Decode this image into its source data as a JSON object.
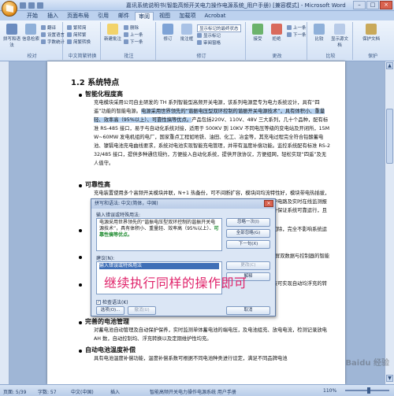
{
  "window": {
    "title": "嘉讯系统说明书(智能高频开关电力操作电源系统_用户手册) [兼容模式] - Microsoft Word",
    "buttons": [
      "–",
      "□",
      "×"
    ]
  },
  "ribbon_tabs": [
    "开始",
    "插入",
    "页面布局",
    "引用",
    "邮件",
    "审阅",
    "视图",
    "加载项",
    "Acrobat"
  ],
  "active_tab": "审阅",
  "ribbon": {
    "groups": [
      "校对",
      "中文简繁转换",
      "批注",
      "修订",
      "更改",
      "比较",
      "保护"
    ],
    "buttons": {
      "spell": "拼写和语法",
      "research": "信息检索",
      "translate": "翻译",
      "tooltip": "翻译屏幕提示",
      "language": "设置语言",
      "wordcount": "字数统计",
      "to_simplified": "繁转简",
      "to_traditional": "简转繁",
      "convert": "简繁转换",
      "new_comment": "新建批注",
      "delete": "删除",
      "prev": "上一条",
      "next": "下一条",
      "track": "修订",
      "balloon": "批注框",
      "markup_combo": "显示标记的最终状态",
      "show_markup": "显示标记",
      "review_pane": "审阅窗格",
      "accept": "接受",
      "reject": "拒绝",
      "change_prev": "上一条",
      "change_next": "下一条",
      "compare": "比较",
      "show_source": "显示源文档",
      "protect": "保护文档"
    }
  },
  "document": {
    "heading": "1.2 系统特点",
    "sections": [
      {
        "title": "智能化程度高",
        "text_before": "充电模块采用公司自主研发的 TH 系列智能型高频开关电源，该系列电源是专为电力系统设计，具有“四遥”功能的智能电源。",
        "highlight": "电源采用世界领先的“谐振电压型双环控制的谐振开关电源技术”，具有体积小、重量轻、效率高（95%以上）、可靠性搞等优点。",
        "text_after": "产品包括220V、110V、48V 三大系列，几十个品种，配有标准 RS-485 接口，易于与自动化系统对接，适用于 500KV 到 10KV 不同电压等级的变电站及开闭所，15MW~60MW 发电机组的电厂，国家重点工程如地铁、油田、化工、冶金等，其充电过程完全符合铅酸蓄电池、镍镉电池充电曲线要求，系统对电池实现智能充电管理，并带有温度补偿功能。监控系统配有标准 RS-232/485 接口，提供多种通信规约，方便接入自动化系统，提供开放协议，方便组网，轻松实现“四遥”及无人值守。"
      },
      {
        "title": "可靠性高",
        "text": "充电装置使用多个高频开关模块并联，N+1 热备份，可不间断扩容，模块间均流特性好，模块带电热插拔，方便维护和扩容；系统配置中包括智能电池监测装置、输入输出浪涌吸收、防雷保护电路及实时在线监测报警；模块具有过压、过流、短路保护，以及监控器的重要部件在失效时通过冗余设计保证系统可靠运行，且对系统无任何影响和冲击，保证运行的可靠性及连续性。"
      },
      {
        "title": "",
        "text": "模块采用智能风冷，外壳及散热器整体设计，抗干扰能力强，底层模块带有故障时切除，完全不影响系统运行。"
      },
      {
        "title": "",
        "text": "系统的主要元器件具有多种保护功能，可适应（无负载开机、负载突变）、触摸式刷屏双数据与控制器的智能控制，系统自动运行中，各项参数设置不丢失。"
      },
      {
        "title": "",
        "text": "在交流输入电压异常或交流停电时，系统不会停止电流供给，可提供自动切换时模块可实现自动均浮充的转换，确保蓄电池组的储能的稳定性和可靠性。"
      },
      {
        "title": "完善的电池管理",
        "text": "对蓄电池自动管理及自动保护保养，实时监测单体蓄电池的端电压，及电池组充、放电电流，检测记录放电 AH 数，自动控制均、浮充转换以及定期维护性均充。"
      },
      {
        "title": "自动电池温度补偿",
        "text": "具有电池温度补偿功能，温度补偿系数可根据不同电池种类进行设定，满足不同品牌电池"
      }
    ]
  },
  "dialog": {
    "title": "拼写和语法: 中文(简体，中国)",
    "not_in_dict_label": "输入错误或特殊用法:",
    "sentence": "电源采用世界领先的“谐振电压型双环控制的谐振开关电源技术”，具有体积小、重量轻、效率高（95%以上）、可靠性搞等优点。",
    "sentence_plain": "电源采用世界领先的“谐振电压型双环控制的谐振开关电源技术”，具有体积小、重量轻、效率高（95%以上）、",
    "sentence_error": "可靠性搞等优点。",
    "suggestions_label": "建议(N):",
    "suggestion_selected": "输入错误或特殊用法",
    "buttons": {
      "ignore_once": "忽略一次(I)",
      "ignore_all": "全部忽略(G)",
      "next_sentence": "下一句(X)",
      "change": "更改(C)",
      "explain": "解释",
      "options": "选项(O)...",
      "undo": "撤消(U)",
      "cancel": "取消"
    },
    "checkbox_label": "检查语法(K)",
    "checkbox_checked": true
  },
  "annotation": "继续执行同样的操作即可",
  "statusbar": {
    "page": "页面: 5/39",
    "words": "字数: 57",
    "lang": "中文(中国)",
    "insert": "插入",
    "zoom": "110%",
    "footer_text": "智能高频开关电力操作电源系统  用户手册"
  },
  "watermark": "Baidu 经验",
  "colors": {
    "ribbon_bg": "#d4e2f5",
    "highlight": "#b6d2f0",
    "annotation": "#e0246b",
    "accent_text": "#1d8a2e"
  }
}
